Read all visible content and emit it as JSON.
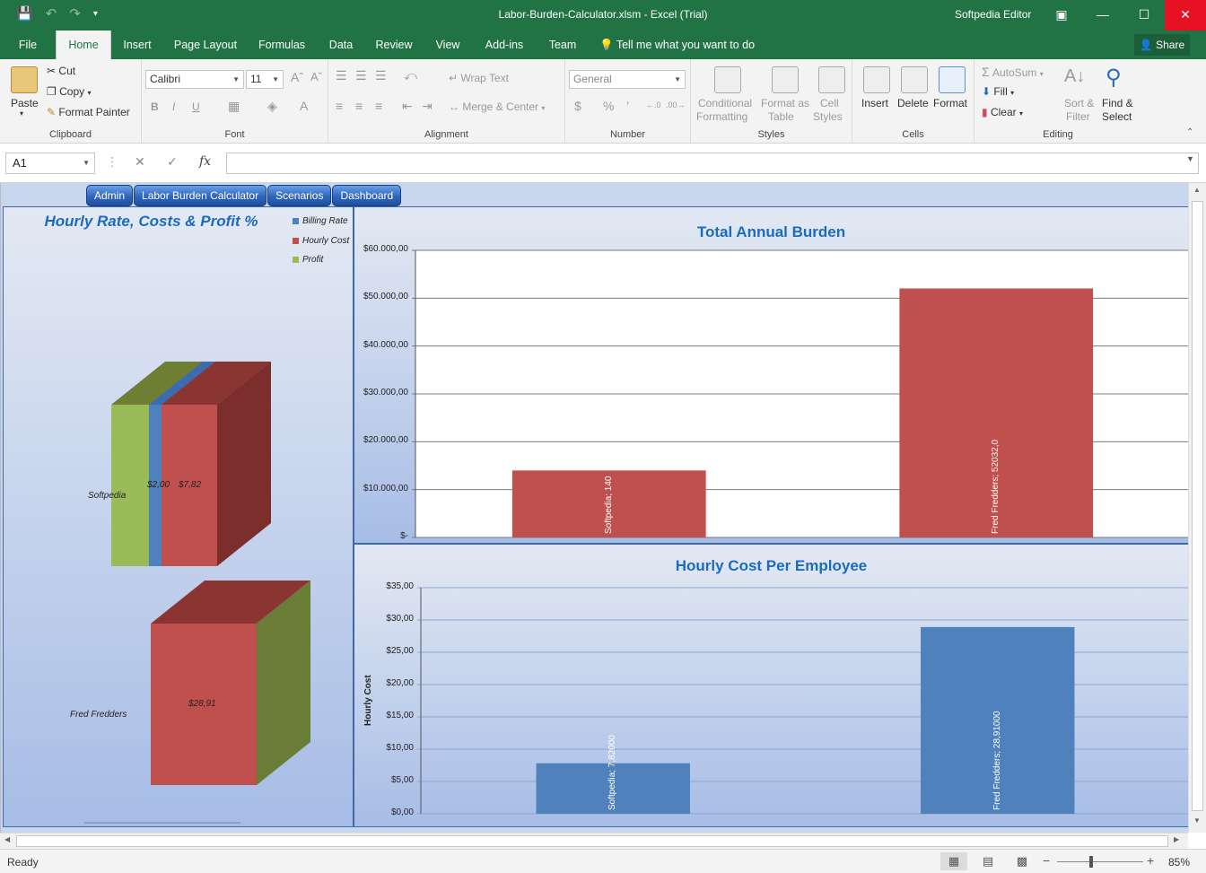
{
  "window": {
    "title": "Labor-Burden-Calculator.xlsm - Excel (Trial)",
    "editor": "Softpedia Editor"
  },
  "menu": {
    "tabs": [
      "File",
      "Home",
      "Insert",
      "Page Layout",
      "Formulas",
      "Data",
      "Review",
      "View",
      "Add-ins",
      "Team"
    ],
    "active": "Home",
    "tell_me": "Tell me what you want to do",
    "share": "Share"
  },
  "ribbon": {
    "clipboard": {
      "label": "Clipboard",
      "paste": "Paste",
      "cut": "Cut",
      "copy": "Copy",
      "format_painter": "Format Painter"
    },
    "font": {
      "label": "Font",
      "name": "Calibri",
      "size": "11"
    },
    "alignment": {
      "label": "Alignment",
      "wrap": "Wrap Text",
      "merge": "Merge & Center"
    },
    "number": {
      "label": "Number",
      "format": "General"
    },
    "styles": {
      "label": "Styles",
      "conditional": "Conditional",
      "conditional2": "Formatting",
      "format_table": "Format as",
      "format_table2": "Table",
      "cell_styles": "Cell",
      "cell_styles2": "Styles"
    },
    "cells": {
      "label": "Cells",
      "insert": "Insert",
      "delete": "Delete",
      "format": "Format"
    },
    "editing": {
      "label": "Editing",
      "autosum": "AutoSum",
      "fill": "Fill",
      "clear": "Clear",
      "sort": "Sort &",
      "sort2": "Filter",
      "find": "Find &",
      "find2": "Select"
    }
  },
  "formula_bar": {
    "name_box": "A1",
    "value": ""
  },
  "nav_buttons": [
    "Admin",
    "Labor Burden Calculator",
    "Scenarios",
    "Dashboard"
  ],
  "status": {
    "ready": "Ready",
    "zoom": "85%"
  },
  "colors": {
    "accent": "#217346",
    "red": "#c0504d",
    "blue": "#4f81bd",
    "green": "#9bbb59"
  },
  "chart_data": [
    {
      "type": "bar",
      "title": "Hourly Rate, Costs & Profit %",
      "categories": [
        "Softpedia",
        "Fred Fredders"
      ],
      "series": [
        {
          "name": "Billing Rate",
          "values": [
            null,
            null
          ]
        },
        {
          "name": "Hourly Cost",
          "values": [
            7.82,
            28.91
          ]
        },
        {
          "name": "Profit",
          "values": [
            null,
            null
          ]
        }
      ],
      "data_labels": [
        "$2,00",
        "$7,82",
        "$28,91"
      ],
      "legend": "top-right"
    },
    {
      "type": "bar",
      "title": "Total Annual Burden",
      "categories": [
        "Softpedia",
        "Fred Fredders"
      ],
      "values": [
        14000,
        52032
      ],
      "data_labels": [
        "Softpedia; 140",
        "Fred Fredders; 52032,0"
      ],
      "yticks": [
        "$-",
        "$10.000,00",
        "$20.000,00",
        "$30.000,00",
        "$40.000,00",
        "$50.000,00",
        "$60.000,00"
      ],
      "ylim": [
        0,
        60000
      ]
    },
    {
      "type": "bar",
      "title": "Hourly Cost Per Employee",
      "ylabel": "Hourly Cost",
      "categories": [
        "Softpedia",
        "Fred Fredders"
      ],
      "values": [
        7.82,
        28.91
      ],
      "data_labels": [
        "Softpedia; 7,82000",
        "Fred Fredders; 28,91000"
      ],
      "yticks": [
        "$0,00",
        "$5,00",
        "$10,00",
        "$15,00",
        "$20,00",
        "$25,00",
        "$30,00",
        "$35,00"
      ],
      "ylim": [
        0,
        35
      ]
    }
  ]
}
